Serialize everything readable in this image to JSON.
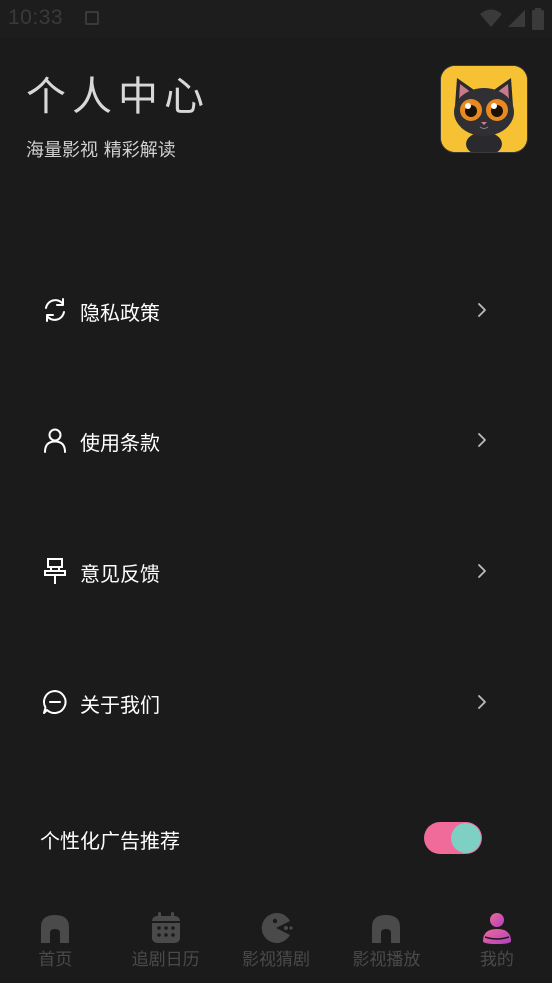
{
  "status_bar": {
    "time": "10:33"
  },
  "header": {
    "title": "个人中心",
    "subtitle": "海量影视 精彩解读",
    "avatar_icon": "black-cat-avatar"
  },
  "menu": [
    {
      "label": "隐私政策",
      "icon": "refresh-icon"
    },
    {
      "label": "使用条款",
      "icon": "user-icon"
    },
    {
      "label": "意见反馈",
      "icon": "pin-icon"
    },
    {
      "label": "关于我们",
      "icon": "chat-icon"
    }
  ],
  "toggle": {
    "label": "个性化广告推荐",
    "on": true,
    "track_color": "#f06a9a",
    "knob_color": "#7ecfc4"
  },
  "bottom_nav": [
    {
      "label": "首页",
      "icon": "home-icon"
    },
    {
      "label": "追剧日历",
      "icon": "calendar-icon"
    },
    {
      "label": "影视猜剧",
      "icon": "pacman-icon"
    },
    {
      "label": "影视播放",
      "icon": "house-icon"
    },
    {
      "label": "我的",
      "icon": "profile-icon",
      "active": true
    }
  ],
  "colors": {
    "background": "#1c1b1c",
    "accent_pink": "#f06a9a",
    "accent_teal": "#7ecfc4",
    "nav_inactive": "#4a4a4a"
  }
}
